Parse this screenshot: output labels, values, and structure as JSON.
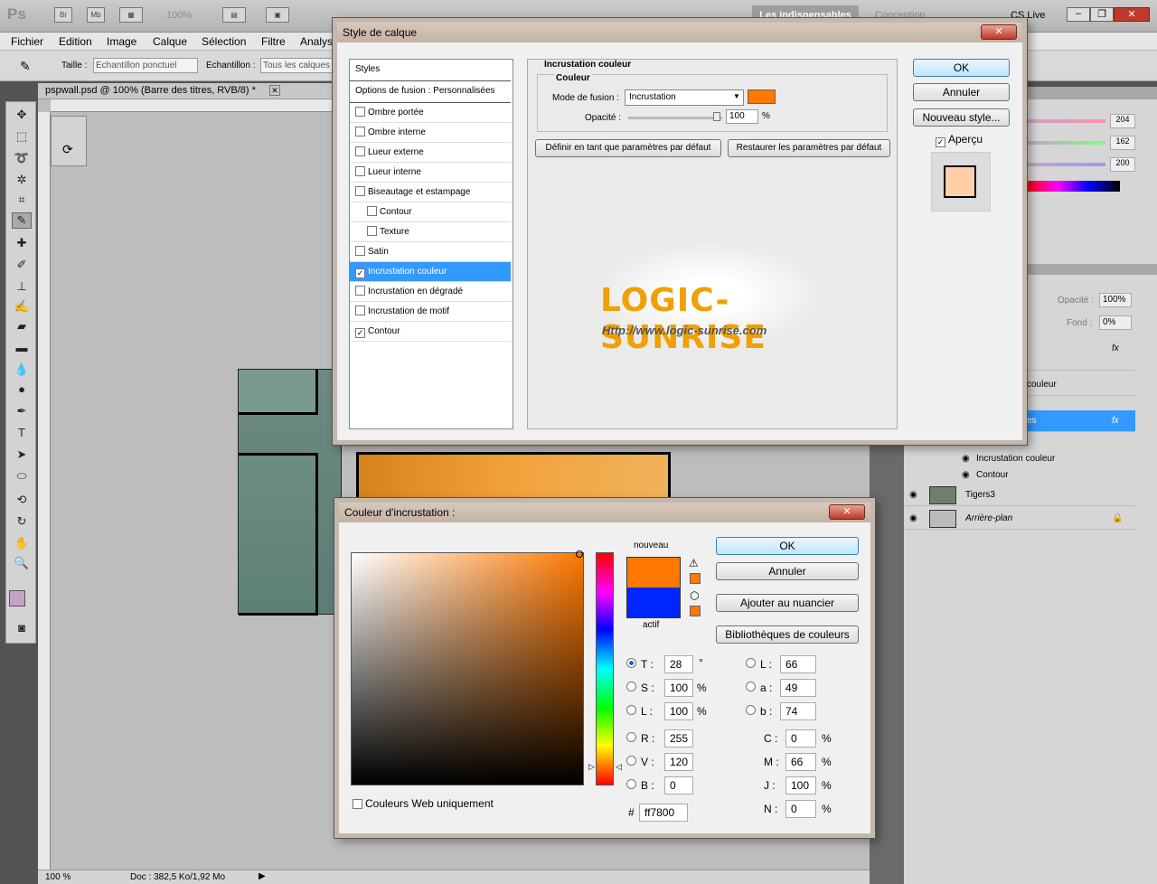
{
  "app": {
    "logo": "Ps",
    "zoom": "100%",
    "workspace_active": "Les indispensables",
    "workspace_other": "Conception",
    "cslive": "CS Live"
  },
  "menu": [
    "Fichier",
    "Edition",
    "Image",
    "Calque",
    "Sélection",
    "Filtre",
    "Analys"
  ],
  "options": {
    "size_label": "Taille :",
    "size_value": "Echantillon ponctuel",
    "sample_label": "Echantillon :",
    "sample_value": "Tous les calques"
  },
  "document": {
    "tab": "pspwall.psd @ 100% (Barre des titres, RVB/8) *",
    "status_zoom": "100 %",
    "status_doc": "Doc : 382,5 Ko/1,92 Mo"
  },
  "style_dialog": {
    "title": "Style de calque",
    "list_header": "Styles",
    "blend_options": "Options de fusion : Personnalisées",
    "effects": [
      {
        "label": "Ombre portée",
        "checked": false,
        "indent": false
      },
      {
        "label": "Ombre interne",
        "checked": false,
        "indent": false
      },
      {
        "label": "Lueur externe",
        "checked": false,
        "indent": false
      },
      {
        "label": "Lueur interne",
        "checked": false,
        "indent": false
      },
      {
        "label": "Biseautage et estampage",
        "checked": false,
        "indent": false
      },
      {
        "label": "Contour",
        "checked": false,
        "indent": true
      },
      {
        "label": "Texture",
        "checked": false,
        "indent": true
      },
      {
        "label": "Satin",
        "checked": false,
        "indent": false
      },
      {
        "label": "Incrustation couleur",
        "checked": true,
        "indent": false,
        "selected": true
      },
      {
        "label": "Incrustation en dégradé",
        "checked": false,
        "indent": false
      },
      {
        "label": "Incrustation de motif",
        "checked": false,
        "indent": false
      },
      {
        "label": "Contour",
        "checked": true,
        "indent": false
      }
    ],
    "section_title": "Incrustation couleur",
    "group_title": "Couleur",
    "blend_mode_label": "Mode de fusion :",
    "blend_mode_value": "Incrustation",
    "opacity_label": "Opacité :",
    "opacity_value": "100",
    "opacity_unit": "%",
    "btn_default": "Définir en tant que paramètres par défaut",
    "btn_restore": "Restaurer les paramètres par défaut",
    "ok": "OK",
    "cancel": "Annuler",
    "new_style": "Nouveau style...",
    "preview": "Aperçu",
    "overlay_color": "#ff7800",
    "watermark_title": "LOGIC-SUNRISE",
    "watermark_url": "Http://www.logic-sunrise.com"
  },
  "color_dialog": {
    "title": "Couleur d'incrustation :",
    "new_label": "nouveau",
    "current_label": "actif",
    "new_color": "#ff7800",
    "current_color": "#0026ff",
    "ok": "OK",
    "cancel": "Annuler",
    "add_swatch": "Ajouter au nuancier",
    "libraries": "Bibliothèques de couleurs",
    "web_only": "Couleurs Web uniquement",
    "hsb": [
      {
        "label": "T :",
        "value": "28",
        "unit": "°",
        "selected": true
      },
      {
        "label": "S :",
        "value": "100",
        "unit": "%"
      },
      {
        "label": "L :",
        "value": "100",
        "unit": "%"
      }
    ],
    "rgb": [
      {
        "label": "R :",
        "value": "255"
      },
      {
        "label": "V :",
        "value": "120"
      },
      {
        "label": "B :",
        "value": "0"
      }
    ],
    "lab": [
      {
        "label": "L :",
        "value": "66"
      },
      {
        "label": "a :",
        "value": "49"
      },
      {
        "label": "b :",
        "value": "74"
      }
    ],
    "cmyk": [
      {
        "label": "C :",
        "value": "0",
        "unit": "%"
      },
      {
        "label": "M :",
        "value": "66",
        "unit": "%"
      },
      {
        "label": "J :",
        "value": "100",
        "unit": "%"
      },
      {
        "label": "N :",
        "value": "0",
        "unit": "%"
      }
    ],
    "hex_label": "#",
    "hex": "ff7800"
  },
  "panels": {
    "color_values": [
      "204",
      "162",
      "200"
    ],
    "opacity_label": "Opacité :",
    "opacity_value": "100%",
    "fill_label": "Fond :",
    "fill_value": "0%",
    "layers": [
      {
        "name": "couleur"
      },
      {
        "name": "es",
        "selected": true
      },
      {
        "name": "Incrustation couleur",
        "effect": true
      },
      {
        "name": "Contour",
        "effect": true
      },
      {
        "name": "Tigers3"
      },
      {
        "name": "Arrière-plan",
        "locked": true
      }
    ]
  }
}
